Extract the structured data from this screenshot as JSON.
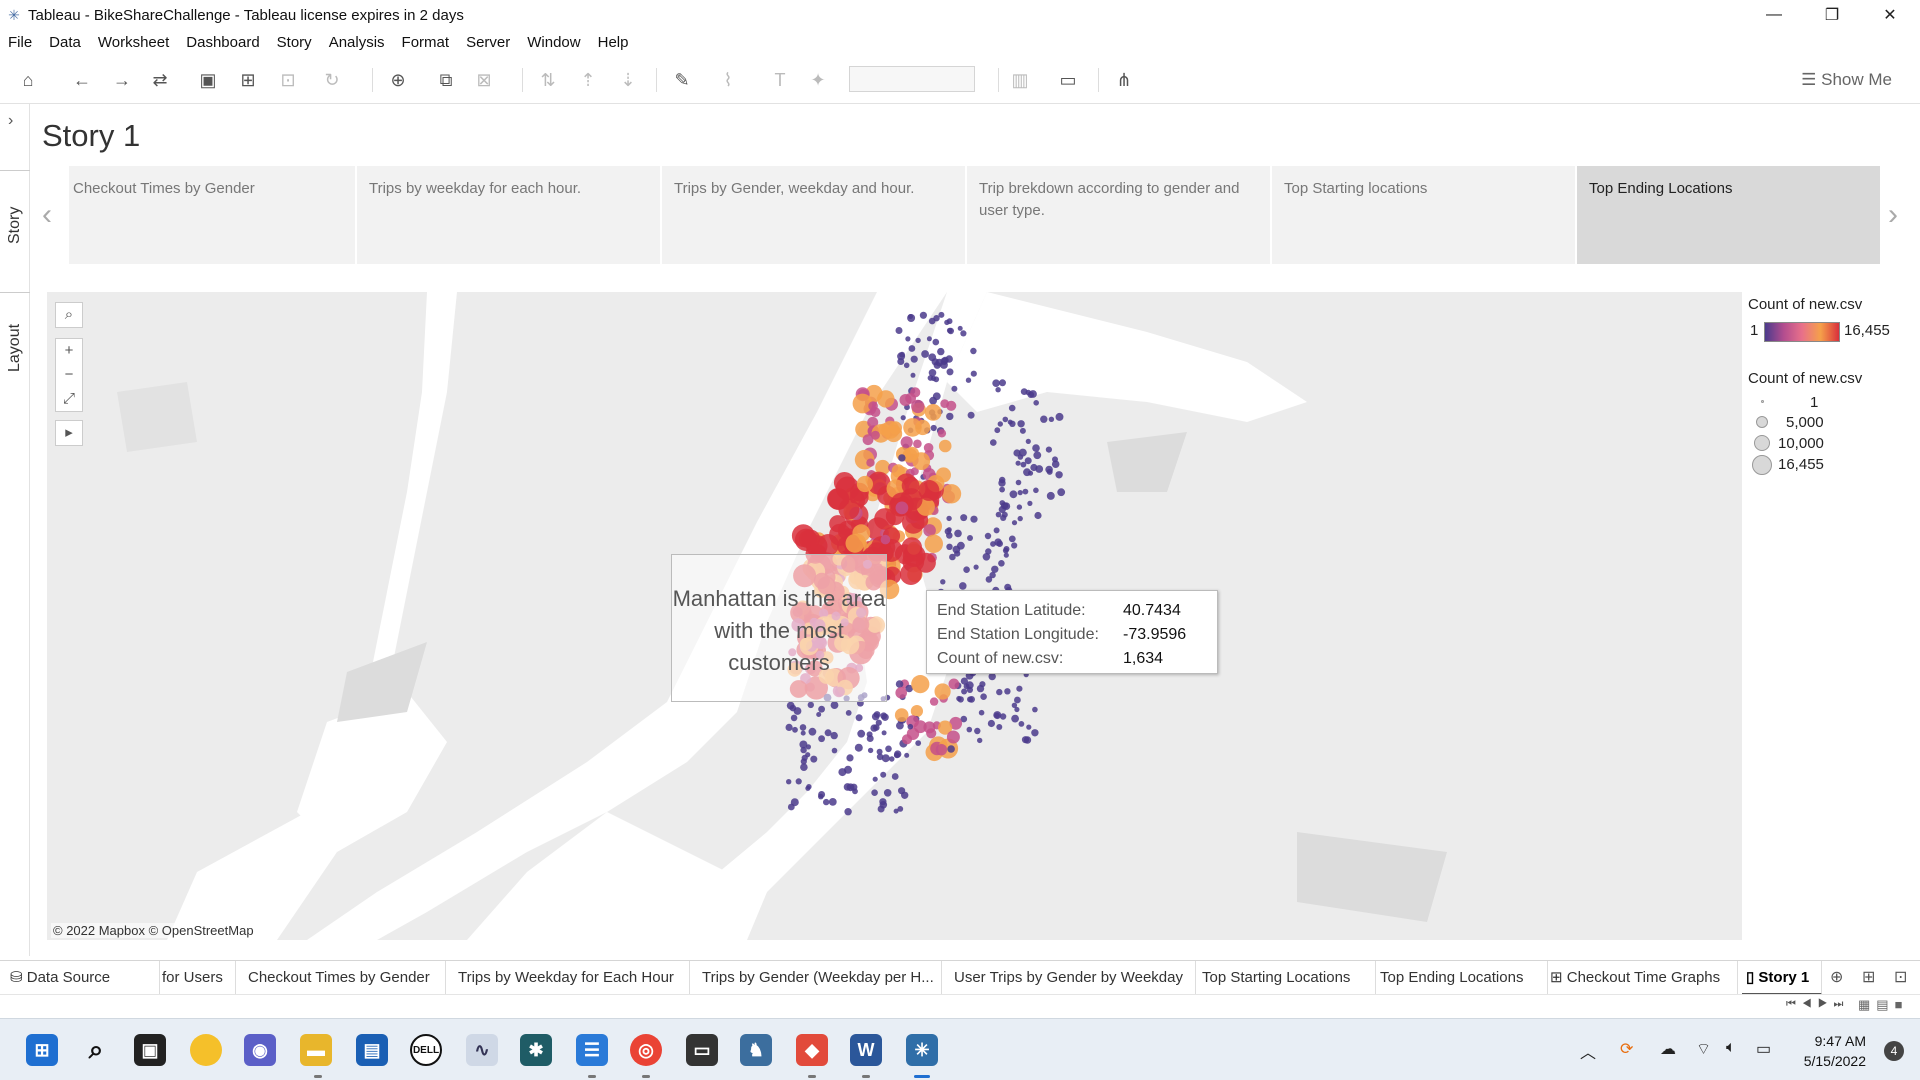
{
  "window": {
    "title": "Tableau - BikeShareChallenge - Tableau license expires in 2 days",
    "minimize": "—",
    "restore": "❐",
    "close": "✕"
  },
  "menu": [
    "File",
    "Data",
    "Worksheet",
    "Dashboard",
    "Story",
    "Analysis",
    "Format",
    "Server",
    "Window",
    "Help"
  ],
  "toolbar": {
    "show_me": "Show Me"
  },
  "left_rail": {
    "story_tab": "Story",
    "layout_tab": "Layout",
    "expand": "›"
  },
  "story": {
    "title": "Story 1",
    "points": [
      "Checkout Times by Gender",
      "Trips by weekday for each hour.",
      "Trips by Gender, weekday and hour.",
      "Trip brekdown according to gender and user type.",
      "Top Starting locations",
      "Top Ending Locations"
    ],
    "active_index": 5,
    "prev_arrow": "‹",
    "next_arrow": "›"
  },
  "map": {
    "attribution": "© 2022 Mapbox © OpenStreetMap",
    "annotation": "Manhattan is the area with the most customers",
    "controls": {
      "search": "⌕",
      "zoom_in": "+",
      "zoom_out": "−",
      "reset": "⤢",
      "expand": "▸"
    }
  },
  "tooltip": {
    "rows": [
      {
        "key": "End Station Latitude:",
        "value": "40.7434"
      },
      {
        "key": "End Station Longitude:",
        "value": "-73.9596"
      },
      {
        "key": "Count of new.csv:",
        "value": "1,634"
      }
    ]
  },
  "legend": {
    "color_title": "Count of new.csv",
    "color_min": "1",
    "color_max": "16,455",
    "size_title": "Count of new.csv",
    "size_items": [
      "1",
      "5,000",
      "10,000",
      "16,455"
    ]
  },
  "sheet_tabs": [
    "Data Source",
    "for Users",
    "Checkout Times by Gender",
    "Trips by Weekday for Each Hour",
    "Trips by Gender (Weekday per H...",
    "User Trips by Gender by Weekday",
    "Top Starting Locations",
    "Top Ending Locations",
    "Checkout Time Graphs",
    "Story 1"
  ],
  "sheet_tabs_active": 9,
  "taskbar": {
    "time": "9:47 AM",
    "date": "5/15/2022",
    "notifications": "4"
  },
  "colors": {
    "low": "#4b3b8c",
    "mid": "#c4508a",
    "high": "#f5a04a",
    "peak": "#d9303c"
  }
}
